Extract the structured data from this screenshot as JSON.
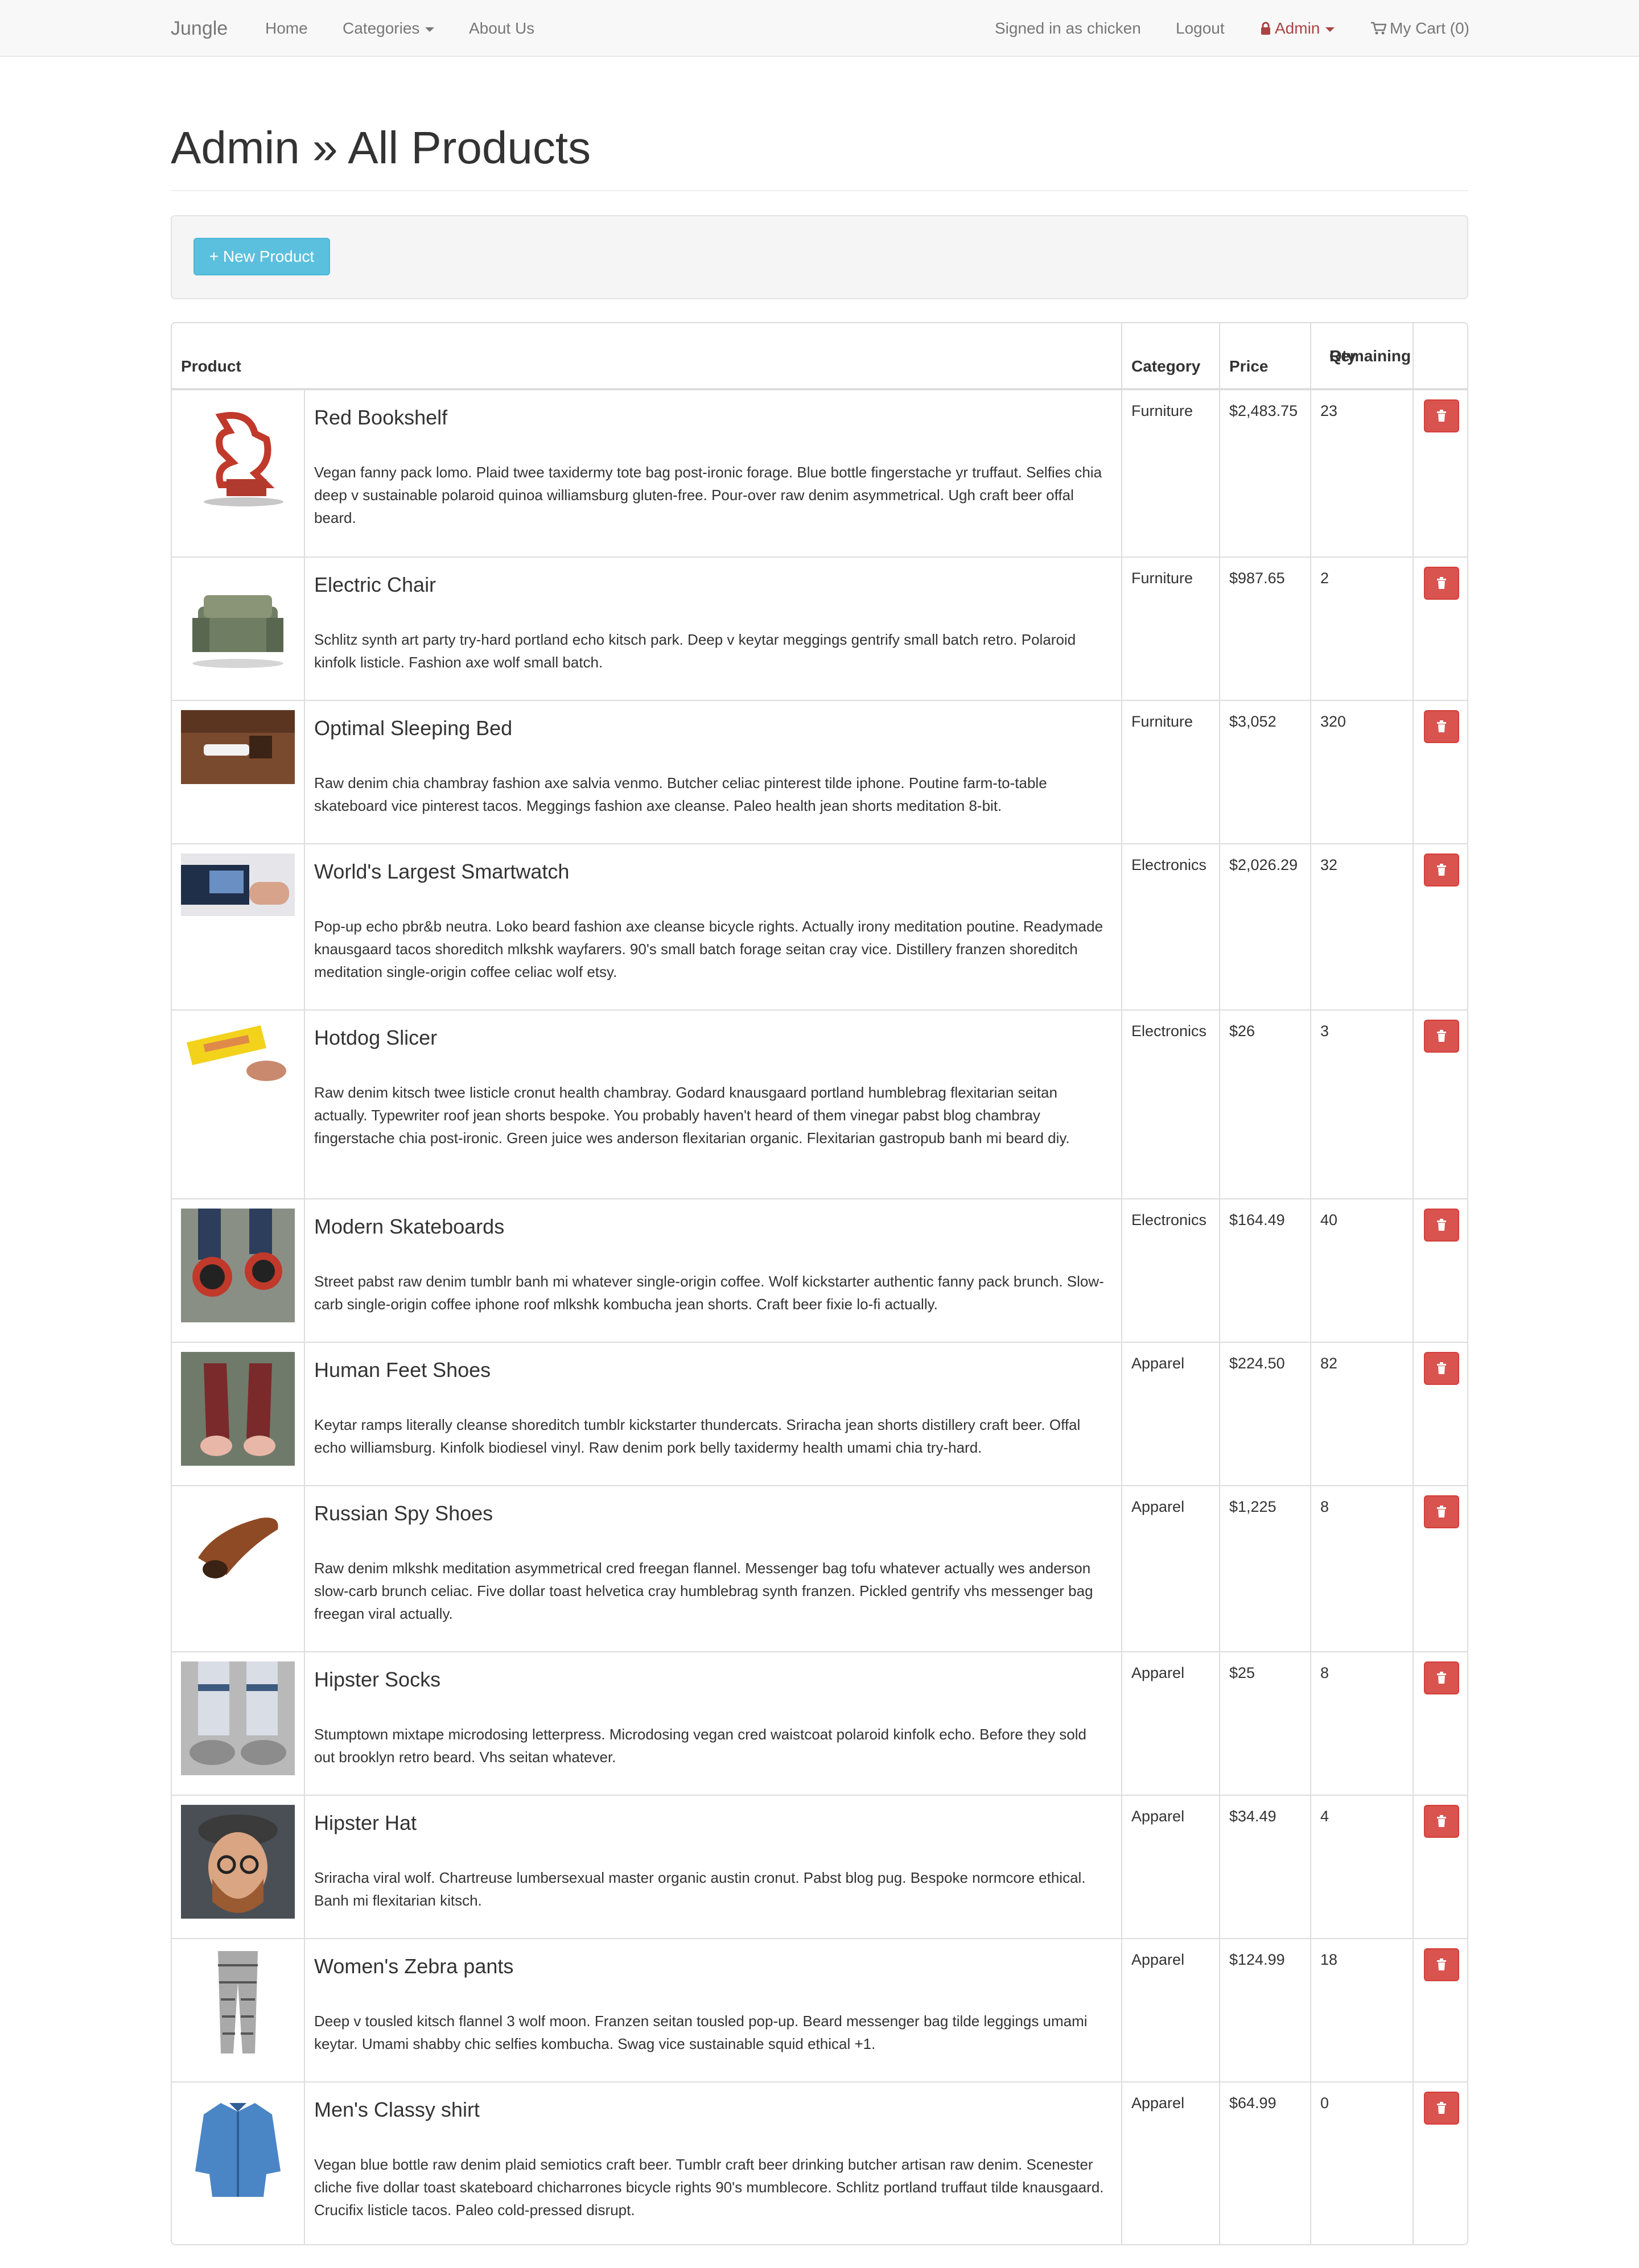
{
  "navbar": {
    "brand": "Jungle",
    "home": "Home",
    "categories": "Categories",
    "about": "About Us",
    "signed_in": "Signed in as chicken",
    "logout": "Logout",
    "admin": "Admin",
    "cart": "My Cart (0)"
  },
  "page": {
    "title": "Admin » All Products",
    "new_product": "+ New Product"
  },
  "table": {
    "headers": {
      "product": "Product",
      "category": "Category",
      "price": "Price",
      "qty_line1": "Qty",
      "qty_line2": "Remaining"
    },
    "rows": [
      {
        "name": "Red Bookshelf",
        "description": "Vegan fanny pack lomo. Plaid twee taxidermy tote bag post-ironic forage. Blue bottle fingerstache yr truffaut. Selfies chia deep v sustainable polaroid quinoa williamsburg gluten-free. Pour-over raw denim asymmetrical. Ugh craft beer offal beard.",
        "category": "Furniture",
        "price": "$2,483.75",
        "qty": "23"
      },
      {
        "name": "Electric Chair",
        "description": "Schlitz synth art party try-hard portland echo kitsch park. Deep v keytar meggings gentrify small batch retro. Polaroid kinfolk listicle. Fashion axe wolf small batch.",
        "category": "Furniture",
        "price": "$987.65",
        "qty": "2"
      },
      {
        "name": "Optimal Sleeping Bed",
        "description": "Raw denim chia chambray fashion axe salvia venmo. Butcher celiac pinterest tilde iphone. Poutine farm-to-table skateboard vice pinterest tacos. Meggings fashion axe cleanse. Paleo health jean shorts meditation 8-bit.",
        "category": "Furniture",
        "price": "$3,052",
        "qty": "320"
      },
      {
        "name": "World's Largest Smartwatch",
        "description": "Pop-up echo pbr&b neutra. Loko beard fashion axe cleanse bicycle rights. Actually irony meditation poutine. Readymade knausgaard tacos shoreditch mlkshk wayfarers. 90's small batch forage seitan cray vice. Distillery franzen shoreditch meditation single-origin coffee celiac wolf etsy.",
        "category": "Electronics",
        "price": "$2,026.29",
        "qty": "32"
      },
      {
        "name": "Hotdog Slicer",
        "description": "Raw denim kitsch twee listicle cronut health chambray. Godard knausgaard portland humblebrag flexitarian seitan actually. Typewriter roof jean shorts bespoke. You probably haven't heard of them vinegar pabst blog chambray fingerstache chia post-ironic. Green juice wes anderson flexitarian organic. Flexitarian gastropub banh mi beard diy.",
        "category": "Electronics",
        "price": "$26",
        "qty": "3"
      },
      {
        "name": "Modern Skateboards",
        "description": "Street pabst raw denim tumblr banh mi whatever single-origin coffee. Wolf kickstarter authentic fanny pack brunch. Slow-carb single-origin coffee iphone roof mlkshk kombucha jean shorts. Craft beer fixie lo-fi actually.",
        "category": "Electronics",
        "price": "$164.49",
        "qty": "40"
      },
      {
        "name": "Human Feet Shoes",
        "description": "Keytar ramps literally cleanse shoreditch tumblr kickstarter thundercats. Sriracha jean shorts distillery craft beer. Offal echo williamsburg. Kinfolk biodiesel vinyl. Raw denim pork belly taxidermy health umami chia try-hard.",
        "category": "Apparel",
        "price": "$224.50",
        "qty": "82"
      },
      {
        "name": "Russian Spy Shoes",
        "description": "Raw denim mlkshk meditation asymmetrical cred freegan flannel. Messenger bag tofu whatever actually wes anderson slow-carb brunch celiac. Five dollar toast helvetica cray humblebrag synth franzen. Pickled gentrify vhs messenger bag freegan viral actually.",
        "category": "Apparel",
        "price": "$1,225",
        "qty": "8"
      },
      {
        "name": "Hipster Socks",
        "description": "Stumptown mixtape microdosing letterpress. Microdosing vegan cred waistcoat polaroid kinfolk echo. Before they sold out brooklyn retro beard. Vhs seitan whatever.",
        "category": "Apparel",
        "price": "$25",
        "qty": "8"
      },
      {
        "name": "Hipster Hat",
        "description": "Sriracha viral wolf. Chartreuse lumbersexual master organic austin cronut. Pabst blog pug. Bespoke normcore ethical. Banh mi flexitarian kitsch.",
        "category": "Apparel",
        "price": "$34.49",
        "qty": "4"
      },
      {
        "name": "Women's Zebra pants",
        "description": "Deep v tousled kitsch flannel 3 wolf moon. Franzen seitan tousled pop-up. Beard messenger bag tilde leggings umami keytar. Umami shabby chic selfies kombucha. Swag vice sustainable squid ethical +1.",
        "category": "Apparel",
        "price": "$124.99",
        "qty": "18"
      },
      {
        "name": "Men's Classy shirt",
        "description": "Vegan blue bottle raw denim plaid semiotics craft beer. Tumblr craft beer drinking butcher artisan raw denim. Scenester cliche five dollar toast skateboard chicharrones bicycle rights 90's mumblecore. Schlitz portland truffaut tilde knausgaard. Crucifix listicle tacos. Paleo cold-pressed disrupt.",
        "category": "Apparel",
        "price": "$64.99",
        "qty": "0"
      }
    ]
  },
  "colors": {
    "navbar_bg": "#f8f8f8",
    "admin_link": "#a94442",
    "new_button": "#5bc0de",
    "delete_button": "#d9534f",
    "border": "#dddddd"
  },
  "icons": {
    "admin": "lock-icon",
    "cart": "shopping-cart-icon",
    "delete": "trash-icon"
  }
}
